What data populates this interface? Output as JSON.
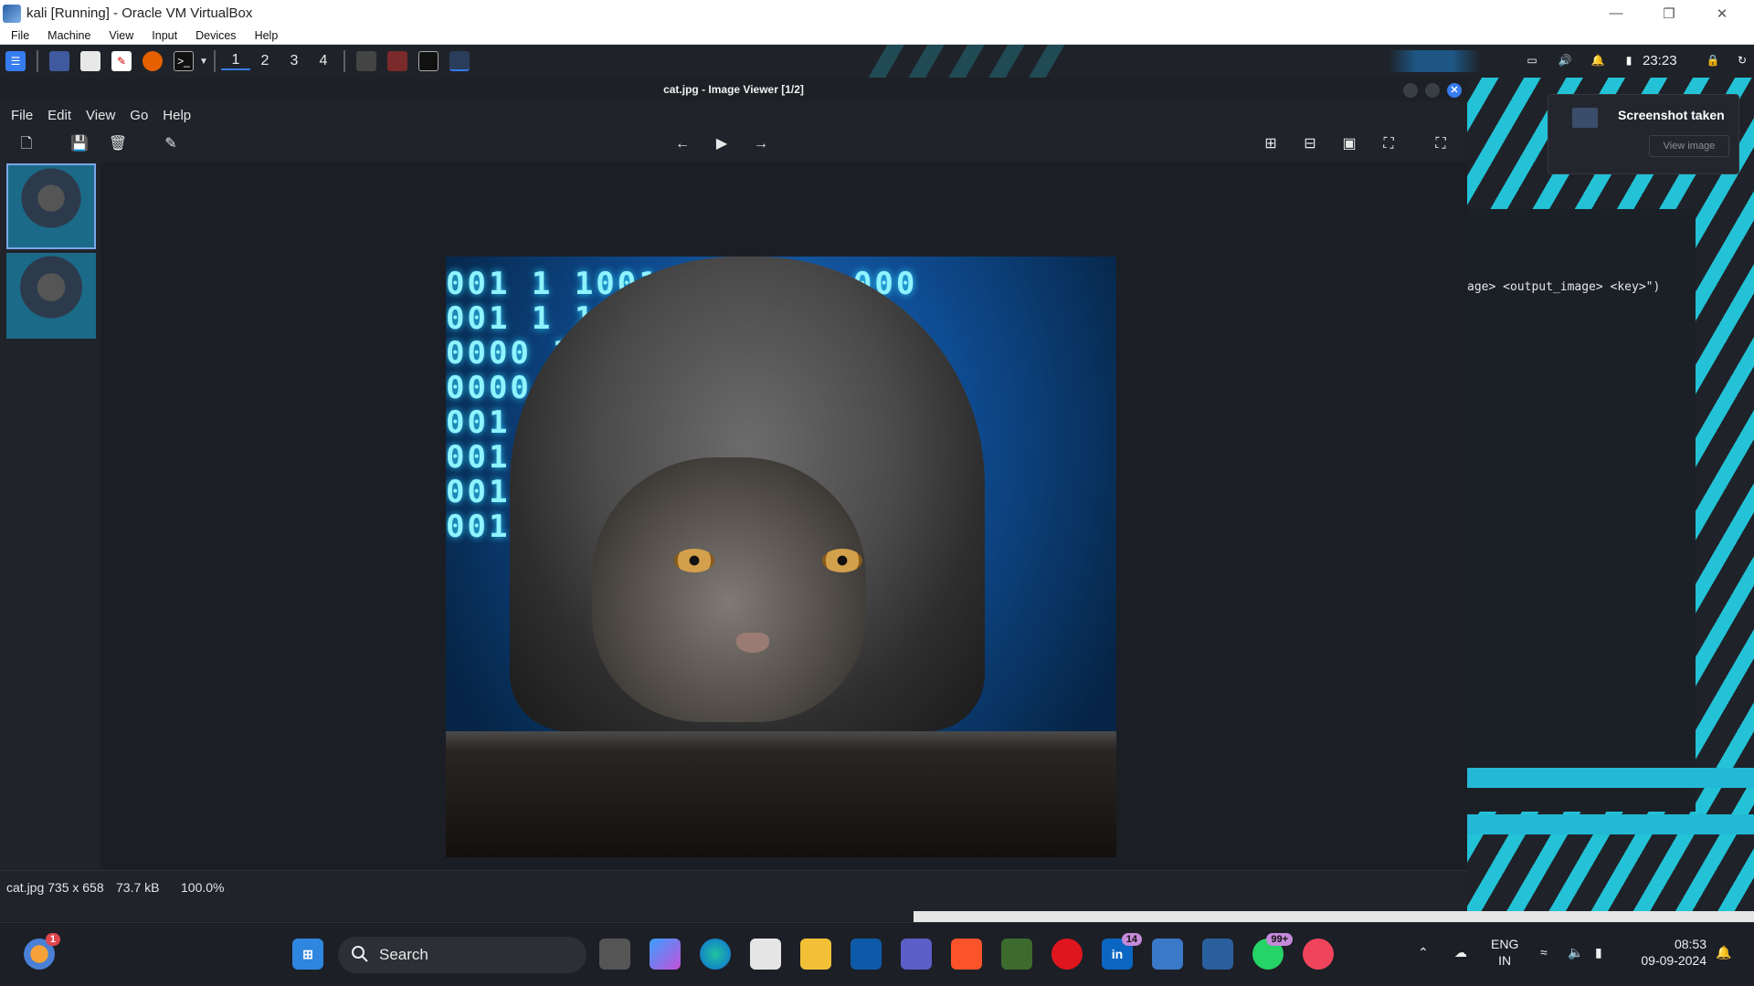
{
  "host": {
    "title": "kali [Running] - Oracle VM VirtualBox",
    "menu": [
      "File",
      "Machine",
      "View",
      "Input",
      "Devices",
      "Help"
    ]
  },
  "kali_panel": {
    "workspaces": [
      "1",
      "2",
      "3",
      "4"
    ],
    "clock": "23:23"
  },
  "notification": {
    "title": "Screenshot taken",
    "button": "View image"
  },
  "terminal": {
    "line": "age> <output_image> <key>\")"
  },
  "viewer": {
    "title": "cat.jpg - Image Viewer [1/2]",
    "menu": [
      "File",
      "Edit",
      "View",
      "Go",
      "Help"
    ],
    "status": {
      "filename_dims": "cat.jpg 735 x 658",
      "size": "73.7 kB",
      "zoom": "100.0%"
    }
  },
  "picture": {
    "rows": [
      "001   1 1001     4 00000 000",
      "001   1 100      0000 8000",
      "0000  318       100000 000",
      "0000  31        10000",
      "001              00000 0",
      "001              00000 000",
      "001              000 0000",
      "001              0000 000"
    ]
  },
  "taskbar": {
    "search_label": "Search",
    "weather_badge": "1",
    "linkedin_badge": "14",
    "whatsapp_badge": "99+",
    "lang_line1": "ENG",
    "lang_line2": "IN",
    "time": "08:53",
    "date": "09-09-2024"
  }
}
